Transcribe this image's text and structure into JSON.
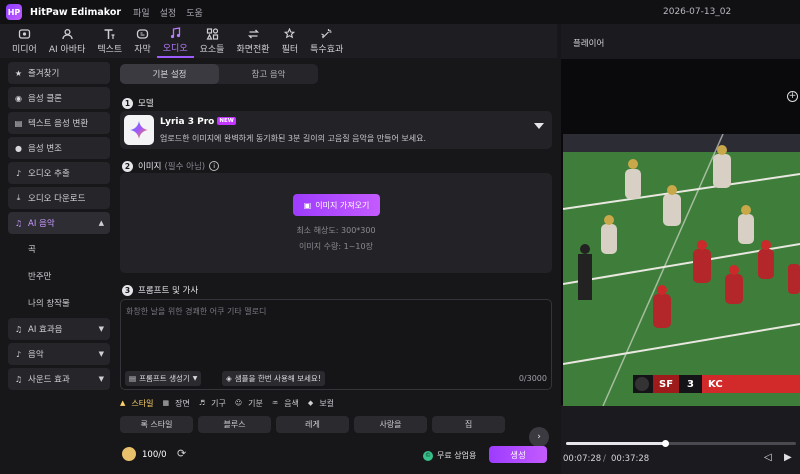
{
  "app": {
    "name": "HitPaw Edimakor",
    "logo_text": "HP",
    "menu": [
      "파일",
      "설정",
      "도움"
    ],
    "document": "2026-07-13_02"
  },
  "toolbar": [
    {
      "label": "미디어",
      "icon": "media-icon"
    },
    {
      "label": "AI 아바타",
      "icon": "ai-avatar-icon"
    },
    {
      "label": "텍스트",
      "icon": "text-icon"
    },
    {
      "label": "자막",
      "icon": "subtitle-icon"
    },
    {
      "label": "오디오",
      "icon": "audio-icon",
      "active": true
    },
    {
      "label": "요소들",
      "icon": "elements-icon"
    },
    {
      "label": "화면전환",
      "icon": "transition-icon"
    },
    {
      "label": "필터",
      "icon": "filter-icon"
    },
    {
      "label": "특수효과",
      "icon": "effects-icon"
    }
  ],
  "sidebar": {
    "items": [
      {
        "label": "즐겨찾기",
        "icon": "★"
      },
      {
        "label": "음성 클론",
        "icon": "◉"
      },
      {
        "label": "텍스트 음성 변환",
        "icon": "▤"
      },
      {
        "label": "음성 변조",
        "icon": "●"
      },
      {
        "label": "오디오 추출",
        "icon": "♪"
      },
      {
        "label": "오디오 다운로드",
        "icon": "⤓"
      },
      {
        "label": "AI 음악",
        "icon": "♫"
      }
    ],
    "sub": [
      "곡",
      "반주만",
      "나의 창작물"
    ],
    "more": [
      {
        "label": "AI 효과음",
        "icon": "♫"
      },
      {
        "label": "음악",
        "icon": "♪"
      },
      {
        "label": "사운드 효과",
        "icon": "♫"
      }
    ]
  },
  "main": {
    "tabs": [
      "기본 설정",
      "참고 음악"
    ],
    "step1": {
      "num": "1",
      "label": "모델"
    },
    "model": {
      "name": "Lyria 3 Pro",
      "badge": "NEW",
      "desc": "업로드한 이미지에 완벽하게 동기화된 3분 길이의 고음질 음악을 만들어 보세요."
    },
    "step2": {
      "num": "2",
      "label": "이미지",
      "note": "(필수 아님)",
      "info": "i"
    },
    "upload": {
      "button": "이미지 가져오기",
      "hint1": "최소 해상도: 300*300",
      "hint2": "이미지 수량: 1~10장"
    },
    "step3": {
      "num": "3",
      "label": "프롬프트 및 가사"
    },
    "prompt": {
      "placeholder": "화창한 날을 위한 경쾌한 어쿠 기타 멜로디",
      "gen_button": "프롬프트 생성기",
      "sample_button": "샘플을 한번 사용해 보세요!",
      "count": "0/3000"
    },
    "categories": [
      {
        "label": "스타일",
        "icon": "▲",
        "active": true
      },
      {
        "label": "장면",
        "icon": "▦"
      },
      {
        "label": "기구",
        "icon": "♬"
      },
      {
        "label": "기분",
        "icon": "☺"
      },
      {
        "label": "음색",
        "icon": "♒"
      },
      {
        "label": "보컬",
        "icon": "◆"
      }
    ],
    "chips": [
      "록 스타일",
      "블루스",
      "레게",
      "사랑을",
      "집",
      ""
    ],
    "footer": {
      "credits": "100/0",
      "free": "무료 상업용",
      "generate": "생성"
    }
  },
  "player": {
    "title": "플레이어",
    "score": {
      "team1": "SF",
      "score": "3",
      "team2": "KC"
    },
    "current_time": "00:07:28",
    "total_time": "00:37:28",
    "progress": 0.43
  }
}
